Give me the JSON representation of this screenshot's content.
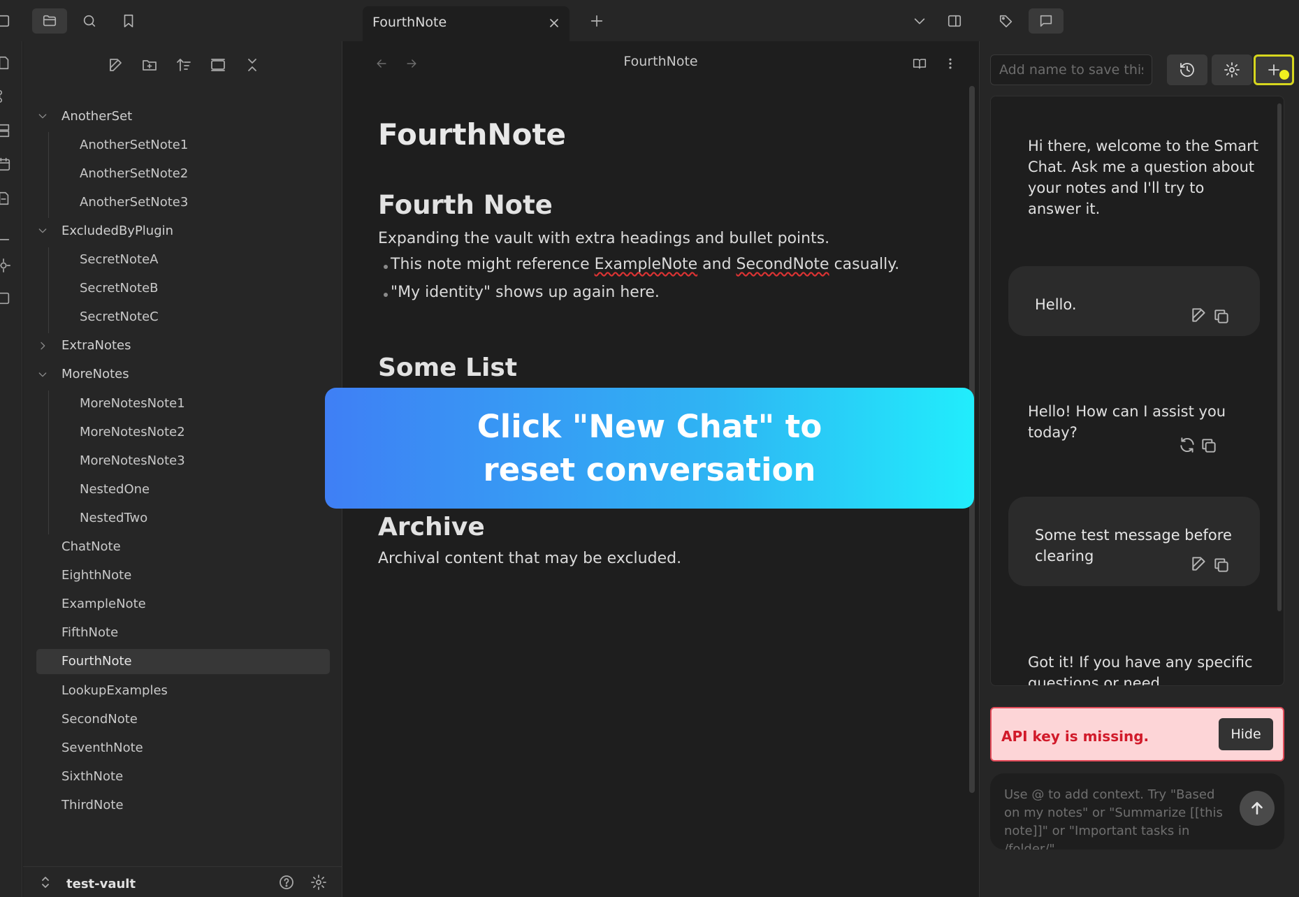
{
  "tab": {
    "title": "FourthNote"
  },
  "sidebar": {
    "tree": [
      {
        "label": "AnotherSet",
        "type": "folder",
        "expanded": true
      },
      {
        "label": "AnotherSetNote1",
        "type": "file"
      },
      {
        "label": "AnotherSetNote2",
        "type": "file"
      },
      {
        "label": "AnotherSetNote3",
        "type": "file"
      },
      {
        "label": "ExcludedByPlugin",
        "type": "folder",
        "expanded": true
      },
      {
        "label": "SecretNoteA",
        "type": "file"
      },
      {
        "label": "SecretNoteB",
        "type": "file"
      },
      {
        "label": "SecretNoteC",
        "type": "file"
      },
      {
        "label": "ExtraNotes",
        "type": "folder",
        "expanded": false
      },
      {
        "label": "MoreNotes",
        "type": "folder",
        "expanded": true
      },
      {
        "label": "MoreNotesNote1",
        "type": "file"
      },
      {
        "label": "MoreNotesNote2",
        "type": "file"
      },
      {
        "label": "MoreNotesNote3",
        "type": "file"
      },
      {
        "label": "NestedOne",
        "type": "file"
      },
      {
        "label": "NestedTwo",
        "type": "file"
      },
      {
        "label": "ChatNote",
        "type": "file"
      },
      {
        "label": "EighthNote",
        "type": "file"
      },
      {
        "label": "ExampleNote",
        "type": "file"
      },
      {
        "label": "FifthNote",
        "type": "file"
      },
      {
        "label": "FourthNote",
        "type": "file",
        "active": true
      },
      {
        "label": "LookupExamples",
        "type": "file"
      },
      {
        "label": "SecondNote",
        "type": "file"
      },
      {
        "label": "SeventhNote",
        "type": "file"
      },
      {
        "label": "SixthNote",
        "type": "file"
      },
      {
        "label": "ThirdNote",
        "type": "file"
      }
    ],
    "vault_name": "test-vault"
  },
  "editor": {
    "view_title": "FourthNote",
    "h1": "FourthNote",
    "section1": {
      "heading": "Fourth Note",
      "intro": "Expanding the vault with extra headings and bullet points.",
      "bullet1": {
        "pre": "This note might reference ",
        "link1": "ExampleNote",
        "mid": " and ",
        "link2": "SecondNote",
        "post": " casually."
      },
      "bullet2": "\"My identity\" shows up again here."
    },
    "section2": {
      "heading": "Some List"
    },
    "section3": {
      "heading": "Archive",
      "text": "Archival content that may be excluded."
    }
  },
  "banner": {
    "text": "Click \"New Chat\" to reset conversation"
  },
  "chat": {
    "name_placeholder": "Add name to save this chat",
    "messages": [
      {
        "role": "assistant",
        "text": "Hi there, welcome to the Smart Chat. Ask me a question about your notes and I'll try to answer it."
      },
      {
        "role": "user",
        "text": "Hello."
      },
      {
        "role": "assistant",
        "text": "Hello! How can I assist you today?"
      },
      {
        "role": "user",
        "text": "Some test message before clearing"
      },
      {
        "role": "assistant",
        "text": "Got it! If you have any specific questions or need"
      }
    ],
    "alert": {
      "text": "API key is missing.",
      "button": "Hide"
    },
    "input_placeholder": "Use @ to add context. Try \"Based on my notes\" or \"Summarize [[this note]]\" or \"Important tasks in /folder/\""
  },
  "colors": {
    "banner_start": "#3f7ff5",
    "banner_end": "#21edfc",
    "alert_bg": "#fdd5d7",
    "alert_text": "#d11a2a",
    "highlight": "#d6d61e"
  },
  "icons": [
    "folder-icon",
    "search-icon",
    "bookmark-icon",
    "close-icon",
    "plus-icon",
    "chevron-down-icon",
    "sidebar-toggle-icon",
    "tags-icon",
    "chat-icon",
    "new-note-icon",
    "new-folder-icon",
    "sort-icon",
    "collapse-icon",
    "close-all-icon",
    "back-icon",
    "forward-icon",
    "reading-view-icon",
    "more-options-icon",
    "history-icon",
    "gear-icon",
    "copy-icon",
    "edit-icon",
    "refresh-icon",
    "send-icon",
    "help-icon",
    "vault-switcher-icon"
  ]
}
